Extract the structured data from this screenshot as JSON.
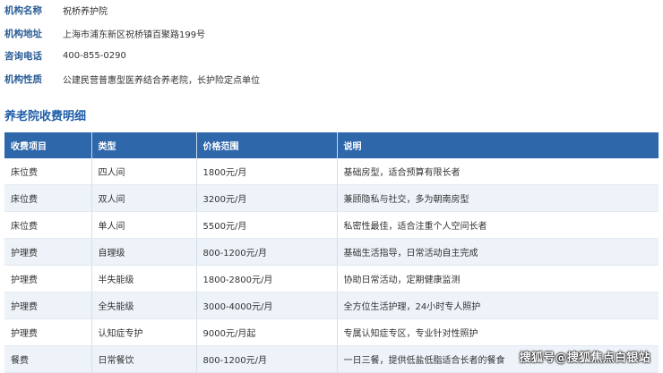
{
  "info": [
    {
      "label": "机构名称",
      "value": "祝桥养护院"
    },
    {
      "label": "机构地址",
      "value": "上海市浦东新区祝桥镇百聚路199号"
    },
    {
      "label": "咨询电话",
      "value": "400-855-0290"
    },
    {
      "label": "机构性质",
      "value": "公建民营普惠型医养结合养老院，长护险定点单位"
    }
  ],
  "section_title": "养老院收费明细",
  "table": {
    "headers": [
      "收费项目",
      "类型",
      "价格范围",
      "说明"
    ],
    "rows": [
      [
        "床位费",
        "四人间",
        "1800元/月",
        "基础房型，适合预算有限长者"
      ],
      [
        "床位费",
        "双人间",
        "3200元/月",
        "兼顾隐私与社交，多为朝南房型"
      ],
      [
        "床位费",
        "单人间",
        "5500元/月",
        "私密性最佳，适合注重个人空间长者"
      ],
      [
        "护理费",
        "自理级",
        "800-1200元/月",
        "基础生活指导，日常活动自主完成"
      ],
      [
        "护理费",
        "半失能级",
        "1800-2800元/月",
        "协助日常活动，定期健康监测"
      ],
      [
        "护理费",
        "全失能级",
        "3000-4000元/月",
        "全方位生活护理，24小时专人照护"
      ],
      [
        "护理费",
        "认知症专护",
        "9000元/月起",
        "专属认知症专区，专业针对性照护"
      ],
      [
        "餐费",
        "日常餐饮",
        "800-1200元/月",
        "一日三餐，提供低盐低脂适合长者的餐食"
      ]
    ]
  },
  "watermark": "搜狐号@搜狐焦点白银站"
}
